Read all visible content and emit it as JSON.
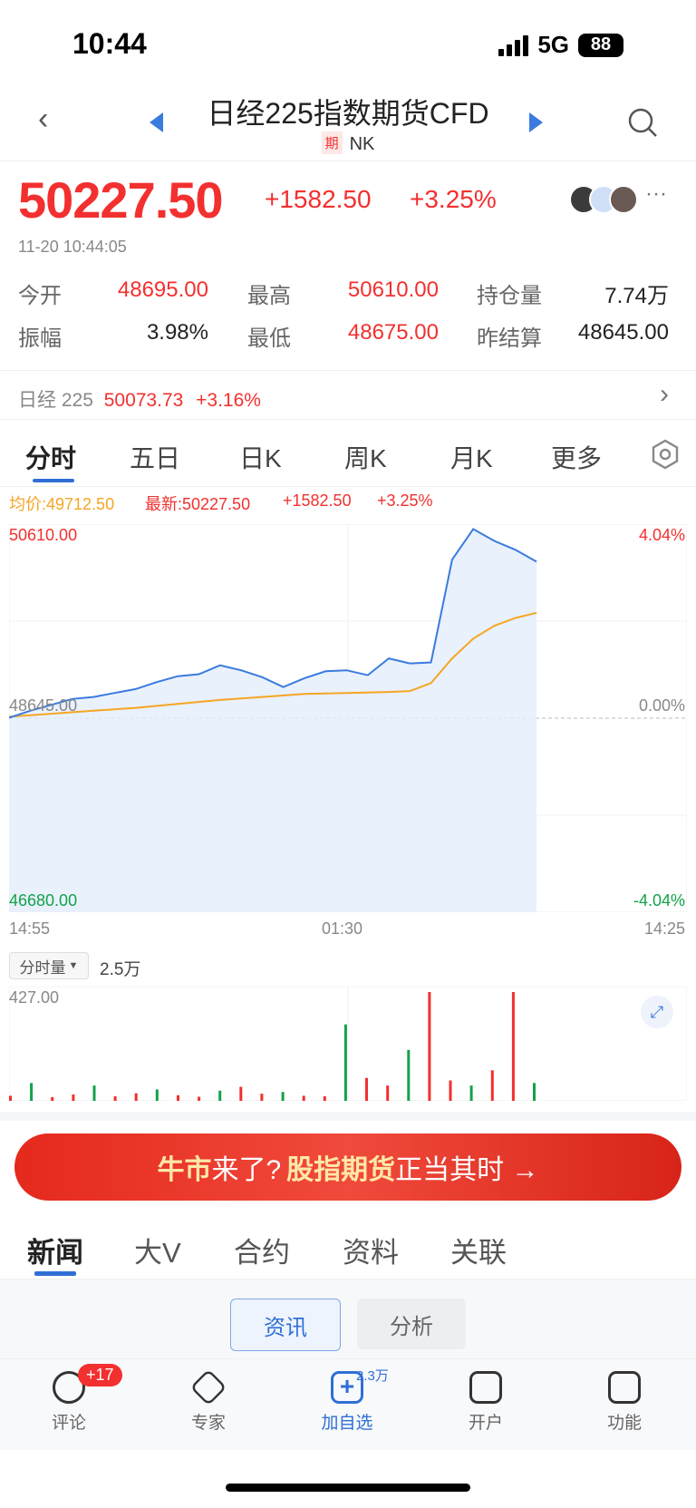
{
  "status_bar": {
    "time": "10:44",
    "network": "5G",
    "battery": "88"
  },
  "header": {
    "title": "日经225指数期货CFD",
    "tag": "期",
    "code": "NK"
  },
  "quote": {
    "price": "50227.50",
    "change": "+1582.50",
    "change_pct": "+3.25%",
    "timestamp": "11-20 10:44:05"
  },
  "stats": {
    "open_label": "今开",
    "open": "48695.00",
    "high_label": "最高",
    "high": "50610.00",
    "oi_label": "持仓量",
    "oi": "7.74万",
    "amp_label": "振幅",
    "amp": "3.98%",
    "low_label": "最低",
    "low": "48675.00",
    "prev_label": "昨结算",
    "prev": "48645.00"
  },
  "related_index": {
    "name": "日经 225",
    "value": "50073.73",
    "change_pct": "+3.16%"
  },
  "chart_tabs": [
    "分时",
    "五日",
    "日K",
    "周K",
    "月K",
    "更多"
  ],
  "chart_legend": {
    "avg": "均价:49712.50",
    "latest": "最新:50227.50",
    "change": "+1582.50",
    "change_pct": "+3.25%"
  },
  "chart_labels": {
    "y_top": "50610.00",
    "y_mid": "48645.00",
    "y_bottom": "46680.00",
    "pct_top": "4.04%",
    "pct_mid": "0.00%",
    "pct_bottom": "-4.04%",
    "x_start": "14:55",
    "x_mid": "01:30",
    "x_end": "14:25"
  },
  "volume": {
    "selector": "分时量",
    "total": "2.5万",
    "max_label": "427.00"
  },
  "chart_data": {
    "type": "line",
    "title": "",
    "x_ticks": [
      "14:55",
      "01:30",
      "14:25"
    ],
    "ylim": [
      46680.0,
      50610.0
    ],
    "prev_settle": 48645.0,
    "series": [
      {
        "name": "最新",
        "x": [
          0,
          4,
          8,
          12,
          16,
          20,
          24,
          28,
          32,
          36,
          40,
          44,
          48,
          52,
          56,
          60,
          64,
          68,
          72,
          76,
          80,
          84,
          88,
          92,
          96,
          100
        ],
        "values": [
          48650,
          48720,
          48780,
          48840,
          48860,
          48900,
          48940,
          49010,
          49070,
          49090,
          49180,
          49130,
          49060,
          48960,
          49050,
          49120,
          49130,
          49080,
          49250,
          49200,
          49210,
          50250,
          50560,
          50440,
          50350,
          50230
        ]
      },
      {
        "name": "均价",
        "x": [
          0,
          8,
          16,
          24,
          32,
          40,
          48,
          56,
          64,
          72,
          76,
          78,
          80,
          84,
          88,
          92,
          96,
          100
        ],
        "values": [
          48660,
          48690,
          48720,
          48750,
          48790,
          48830,
          48860,
          48890,
          48900,
          48910,
          48920,
          48960,
          49000,
          49250,
          49450,
          49580,
          49660,
          49712
        ]
      }
    ],
    "volume_ylim": [
      0,
      427
    ],
    "volume": [
      20,
      70,
      15,
      25,
      60,
      18,
      30,
      45,
      22,
      16,
      40,
      55,
      28,
      35,
      20,
      18,
      300,
      90,
      60,
      200,
      427,
      80,
      60,
      120,
      427,
      70
    ]
  },
  "banner": {
    "part1": "牛市",
    "part2": "来了?",
    "part3": "股指期货",
    "part4": "正当其时 →"
  },
  "news_tabs": [
    "新闻",
    "大V",
    "合约",
    "资料",
    "关联"
  ],
  "segments": {
    "left": "资讯",
    "right": "分析"
  },
  "bottom_bar": {
    "comment": "评论",
    "comment_badge": "+17",
    "expert": "专家",
    "watch": "加自选",
    "watch_count": "2.3万",
    "open_acct": "开户",
    "functions": "功能"
  },
  "colors": {
    "up": "#f2302f",
    "down": "#12a24a",
    "accent": "#3a7bdf",
    "avg_line": "#f5a623"
  }
}
